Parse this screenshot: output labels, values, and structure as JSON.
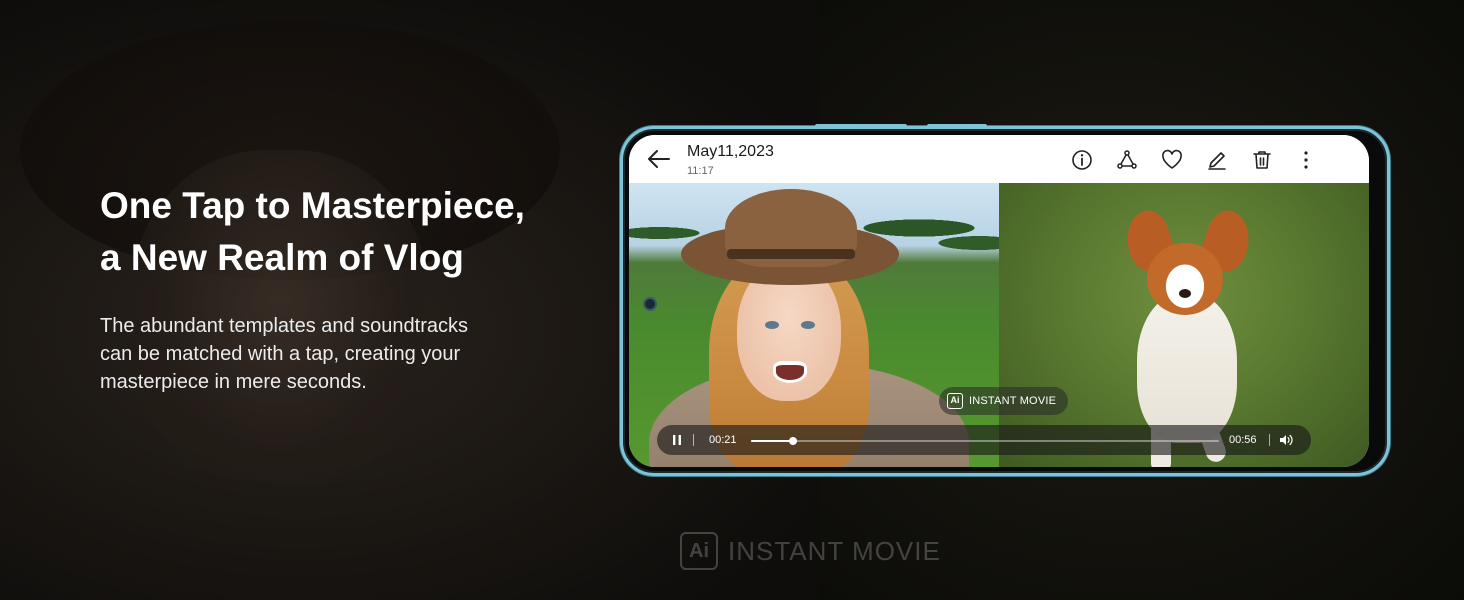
{
  "hero": {
    "headline_line1": "One Tap to Masterpiece,",
    "headline_line2": "a New Realm of Vlog",
    "description": "The abundant templates and soundtracks can be matched with a tap, creating your masterpiece in mere seconds."
  },
  "watermark": {
    "badge": "Ai",
    "label": "INSTANT MOVIE"
  },
  "gallery": {
    "date": "May11,2023",
    "time": "11:17",
    "toolbar_icons": [
      "info-icon",
      "share-icon",
      "favorite-icon",
      "edit-icon",
      "delete-icon",
      "more-icon"
    ],
    "instant_movie": {
      "badge": "Ai",
      "label": "INSTANT MOVIE"
    },
    "player": {
      "current_time": "00:21",
      "total_time": "00:56",
      "progress": 0.09
    }
  },
  "colors": {
    "phone_frame": "#7ec3d6",
    "background": "#0d0c0a"
  }
}
